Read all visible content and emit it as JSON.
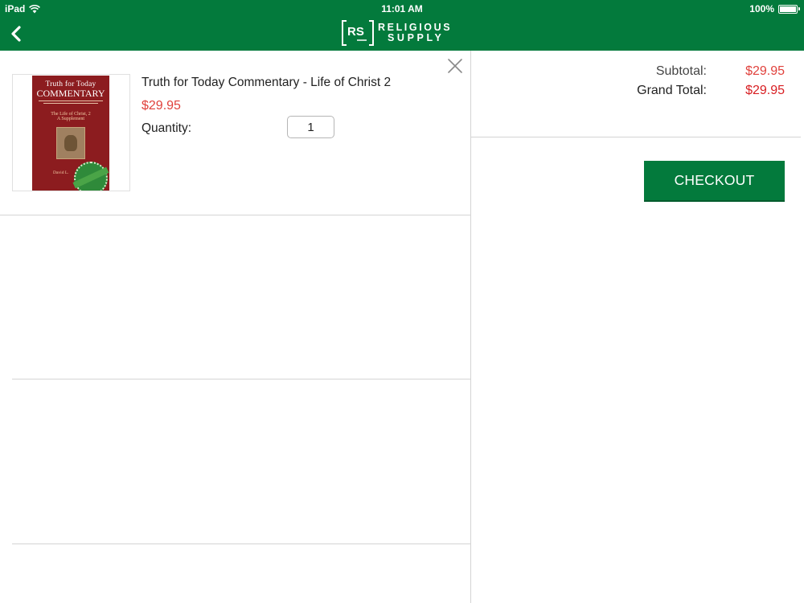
{
  "status_bar": {
    "carrier": "iPad",
    "time": "11:01 AM",
    "battery": "100%"
  },
  "header": {
    "logo_mark": "RS",
    "logo_line1": "RELIGIOUS",
    "logo_line2": "SUPPLY",
    "brand_color": "#037a3c"
  },
  "cart": {
    "items": [
      {
        "title": "Truth for Today Commentary - Life of Christ 2",
        "price": "$29.95",
        "quantity_label": "Quantity:",
        "quantity": "1",
        "cover": {
          "line1": "Truth for Today",
          "line2": "COMMENTARY",
          "sub1": "The Life of Christ, 2",
          "sub2": "A Supplement",
          "author": "David L."
        }
      }
    ]
  },
  "totals": {
    "subtotal_label": "Subtotal:",
    "subtotal_value": "$29.95",
    "grand_total_label": "Grand Total:",
    "grand_total_value": "$29.95"
  },
  "actions": {
    "checkout_label": "CHECKOUT"
  },
  "icons": {
    "back": "chevron-left-icon",
    "close": "close-icon",
    "wifi": "wifi-icon",
    "battery": "battery-icon"
  },
  "colors": {
    "accent": "#037a3c",
    "price": "#e0413c",
    "grand_total": "#d81e22"
  }
}
